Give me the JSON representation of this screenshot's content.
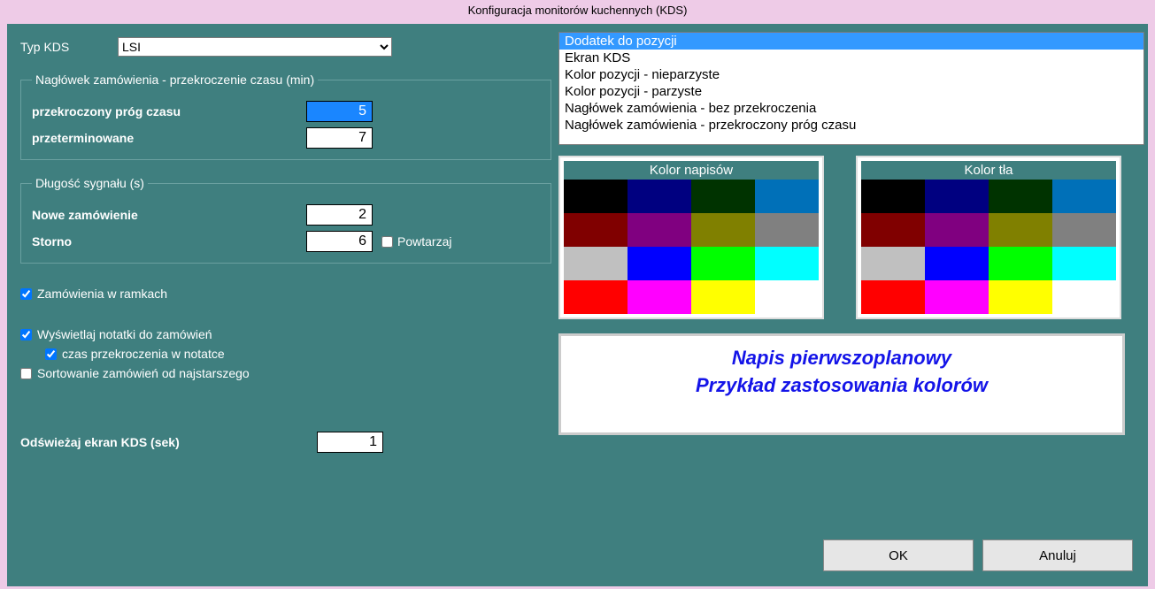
{
  "window_title": "Konfiguracja monitorów kuchennych (KDS)",
  "kds_type_label": "Typ KDS",
  "kds_type_value": "LSI",
  "fieldset_time": {
    "legend": "Nagłówek zamówienia - przekroczenie czasu (min)",
    "threshold_label": "przekroczony próg czasu",
    "threshold_value": "5",
    "expired_label": "przeterminowane",
    "expired_value": "7"
  },
  "fieldset_signal": {
    "legend": "Długość sygnału (s)",
    "new_label": "Nowe zamówienie",
    "new_value": "2",
    "storno_label": "Storno",
    "storno_value": "6",
    "repeat_label": "Powtarzaj",
    "repeat_checked": false
  },
  "cb_frames": {
    "label": "Zamówienia w ramkach",
    "checked": true
  },
  "cb_notes": {
    "label": "Wyświetlaj notatki do zamówień",
    "checked": true
  },
  "cb_time_in_note": {
    "label": "czas przekroczenia w notatce",
    "checked": true
  },
  "cb_sort_oldest": {
    "label": "Sortowanie zamówień od najstarszego",
    "checked": false
  },
  "refresh": {
    "label": "Odświeżaj ekran KDS (sek)",
    "value": "1"
  },
  "listbox_items": [
    "Dodatek do pozycji",
    "Ekran KDS",
    "Kolor pozycji - nieparzyste",
    "Kolor pozycji - parzyste",
    "Nagłówek zamówienia - bez przekroczenia",
    "Nagłówek zamówienia - przekroczony próg czasu"
  ],
  "listbox_selected_index": 0,
  "palette_text_title": "Kolor napisów",
  "palette_bg_title": "Kolor tła",
  "palette_colors": [
    "#000000",
    "#000080",
    "#003300",
    "#0070b8",
    "#800000",
    "#800080",
    "#808000",
    "#808080",
    "#c0c0c0",
    "#0000ff",
    "#00ff00",
    "#00ffff",
    "#ff0000",
    "#ff00ff",
    "#ffff00",
    "#ffffff"
  ],
  "preview_line1": "Napis pierwszoplanowy",
  "preview_line2": "Przykład zastosowania kolorów",
  "btn_ok": "OK",
  "btn_cancel": "Anuluj"
}
